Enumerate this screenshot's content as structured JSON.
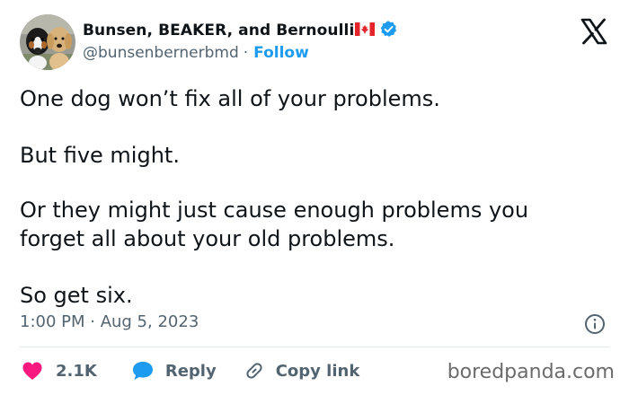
{
  "author": {
    "display_name": "Bunsen, BEAKER, and Bernoulli",
    "flag_icon": "canada-flag-icon",
    "verified_icon": "verified-badge-icon",
    "handle": "@bunsenbernerbmd",
    "separator": "·",
    "follow_label": "Follow"
  },
  "tweet": {
    "paragraphs": [
      "One dog won’t fix all of your problems.",
      "But five might.",
      "Or they might just cause enough problems you forget all about your old problems.",
      "So get six."
    ],
    "timestamp": "1:00 PM · Aug 5, 2023"
  },
  "actions": {
    "like_count": "2.1K",
    "reply_label": "Reply",
    "copy_link_label": "Copy link"
  },
  "watermark": "boredpanda.com",
  "colors": {
    "accent": "#1d9bf0",
    "like": "#f91880",
    "secondary_text": "#536471",
    "primary_text": "#0f1419"
  }
}
